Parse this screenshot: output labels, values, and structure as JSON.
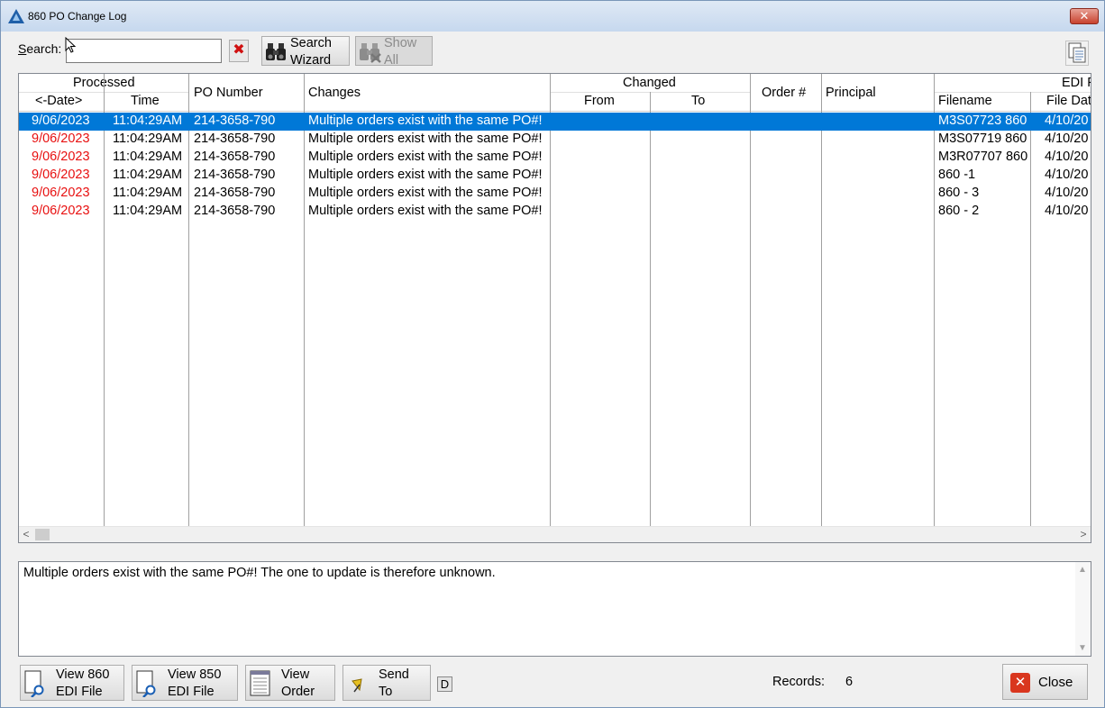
{
  "window": {
    "title": "860 PO Change Log",
    "close_glyph": "✕"
  },
  "search": {
    "label": "Search:",
    "value": "",
    "clear_glyph": "✖"
  },
  "toolbar": {
    "search_wizard": [
      "Search",
      "Wizard"
    ],
    "show_all": [
      "Show",
      "All"
    ]
  },
  "grid": {
    "group_headers": {
      "processed": "Processed",
      "changed": "Changed",
      "edi": "EDI F"
    },
    "columns": {
      "date": "<-Date>",
      "time": "Time",
      "po_number": "PO Number",
      "changes": "Changes",
      "from": "From",
      "to": "To",
      "order_num": "Order #",
      "principal": "Principal",
      "filename": "Filename",
      "file_date": "File Dat"
    },
    "rows": [
      {
        "date": "9/06/2023",
        "time": "11:04:29AM",
        "po": "214-3658-790",
        "changes": "Multiple orders exist with the same PO#!",
        "from": "",
        "to": "",
        "order": "",
        "principal": "",
        "filename": "M3S07723 860",
        "file_date": "4/10/20"
      },
      {
        "date": "9/06/2023",
        "time": "11:04:29AM",
        "po": "214-3658-790",
        "changes": "Multiple orders exist with the same PO#!",
        "from": "",
        "to": "",
        "order": "",
        "principal": "",
        "filename": "M3S07719 860",
        "file_date": "4/10/20"
      },
      {
        "date": "9/06/2023",
        "time": "11:04:29AM",
        "po": "214-3658-790",
        "changes": "Multiple orders exist with the same PO#!",
        "from": "",
        "to": "",
        "order": "",
        "principal": "",
        "filename": "M3R07707 860",
        "file_date": "4/10/20"
      },
      {
        "date": "9/06/2023",
        "time": "11:04:29AM",
        "po": "214-3658-790",
        "changes": "Multiple orders exist with the same PO#!",
        "from": "",
        "to": "",
        "order": "",
        "principal": "",
        "filename": "860 -1",
        "file_date": "4/10/20"
      },
      {
        "date": "9/06/2023",
        "time": "11:04:29AM",
        "po": "214-3658-790",
        "changes": "Multiple orders exist with the same PO#!",
        "from": "",
        "to": "",
        "order": "",
        "principal": "",
        "filename": "860 - 3",
        "file_date": "4/10/20"
      },
      {
        "date": "9/06/2023",
        "time": "11:04:29AM",
        "po": "214-3658-790",
        "changes": "Multiple orders exist with the same PO#!",
        "from": "",
        "to": "",
        "order": "",
        "principal": "",
        "filename": "860 - 2",
        "file_date": "4/10/20"
      }
    ],
    "selected_row": 0,
    "scroll_left": "<",
    "scroll_right": ">"
  },
  "memo": {
    "text": "Multiple orders exist with the same PO#! The one to update is therefore unknown."
  },
  "buttons": {
    "view860": [
      "View 860",
      "EDI File"
    ],
    "view850": [
      "View 850",
      "EDI File"
    ],
    "view_order": [
      "View",
      "Order"
    ],
    "send_to": [
      "Send",
      "To"
    ],
    "d": "D",
    "close": "Close"
  },
  "records": {
    "label": "Records:",
    "count": "6"
  },
  "colors": {
    "selected_row": "#0078d7",
    "date_text": "#e81010",
    "close_icon": "#d9361e"
  }
}
